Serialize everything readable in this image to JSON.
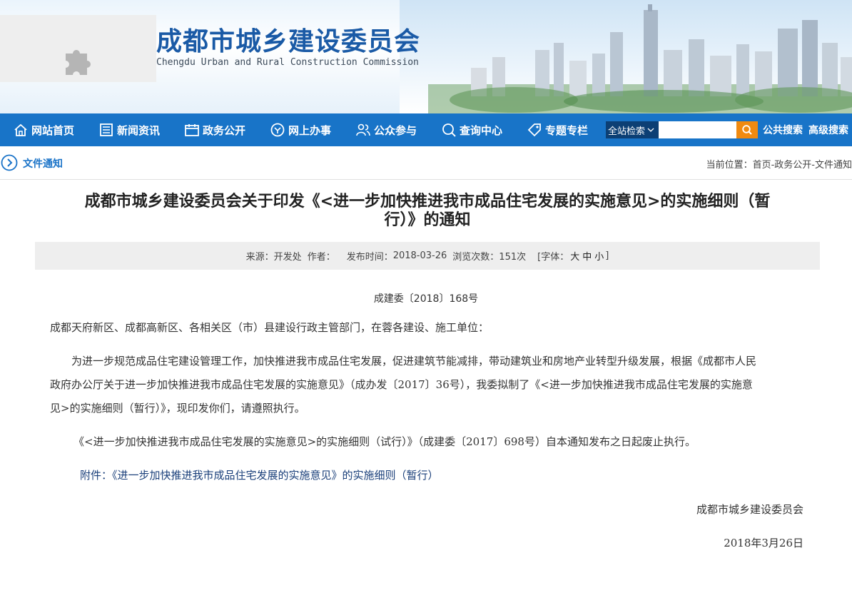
{
  "header": {
    "title": "成都市城乡建设委员会",
    "subtitle": "Chengdu Urban and Rural Construction Commission",
    "logo_icon": "puzzle-icon"
  },
  "nav": {
    "items": [
      {
        "label": "网站首页",
        "icon": "home-icon"
      },
      {
        "label": "新闻资讯",
        "icon": "news-icon"
      },
      {
        "label": "政务公开",
        "icon": "calendar-icon"
      },
      {
        "label": "网上办事",
        "icon": "service-icon"
      },
      {
        "label": "公众参与",
        "icon": "people-icon"
      },
      {
        "label": "查询中心",
        "icon": "search-icon"
      },
      {
        "label": "专题专栏",
        "icon": "tag-icon"
      }
    ],
    "search_scope": "全站检索",
    "search_value": "",
    "public_search": "公共搜索",
    "advanced_search": "高级搜索",
    "bar_color": "#1874c8",
    "search_button_color": "#f08a10"
  },
  "breadcrumb": {
    "section": "文件通知",
    "prefix": "当前位置：",
    "home": "首页",
    "level1": "-政务公开",
    "level2": "-文件通知"
  },
  "article": {
    "title_line1": "成都市城乡建设委员会关于印发《<进一步加快推进我市成品住宅发展的实施意见>的实施细则（暂",
    "title_line2": "行）》的通知",
    "meta": {
      "source_label": "来源：",
      "source": "开发处",
      "author_label": "作者：",
      "author": "",
      "date_label": "发布时间：",
      "date": "2018-03-26",
      "views_label": "浏览次数：",
      "views": "151次",
      "font_label": "[字体：",
      "font_large": "大",
      "font_medium": "中",
      "font_small": "小",
      "font_close": "]"
    },
    "doc_number": "成建委〔2018〕168号",
    "salutation": "成都天府新区、成都高新区、各相关区（市）县建设行政主管部门，在蓉各建设、施工单位：",
    "para1_line1": "为进一步规范成品住宅建设管理工作，加快推进我市成品住宅发展，促进建筑节能减排，带动建筑业和房地产业转型升级发展，根据《成都市人民",
    "para1_line2": "政府办公厅关于进一步加快推进我市成品住宅发展的实施意见》（成办发〔2017〕36号），我委拟制了《<进一步加快推进我市成品住宅发展的实施意",
    "para1_line3": "见>的实施细则（暂行）》，现印发你们，请遵照执行。",
    "para2": "《<进一步加快推进我市成品住宅发展的实施意见>的实施细则（试行）》（成建委〔2017〕698号）自本通知发布之日起废止执行。",
    "attachment": "附件：《进一步加快推进我市成品住宅发展的实施意见》的实施细则（暂行）",
    "signature": "成都市城乡建设委员会",
    "sign_date": "2018年3月26日"
  }
}
